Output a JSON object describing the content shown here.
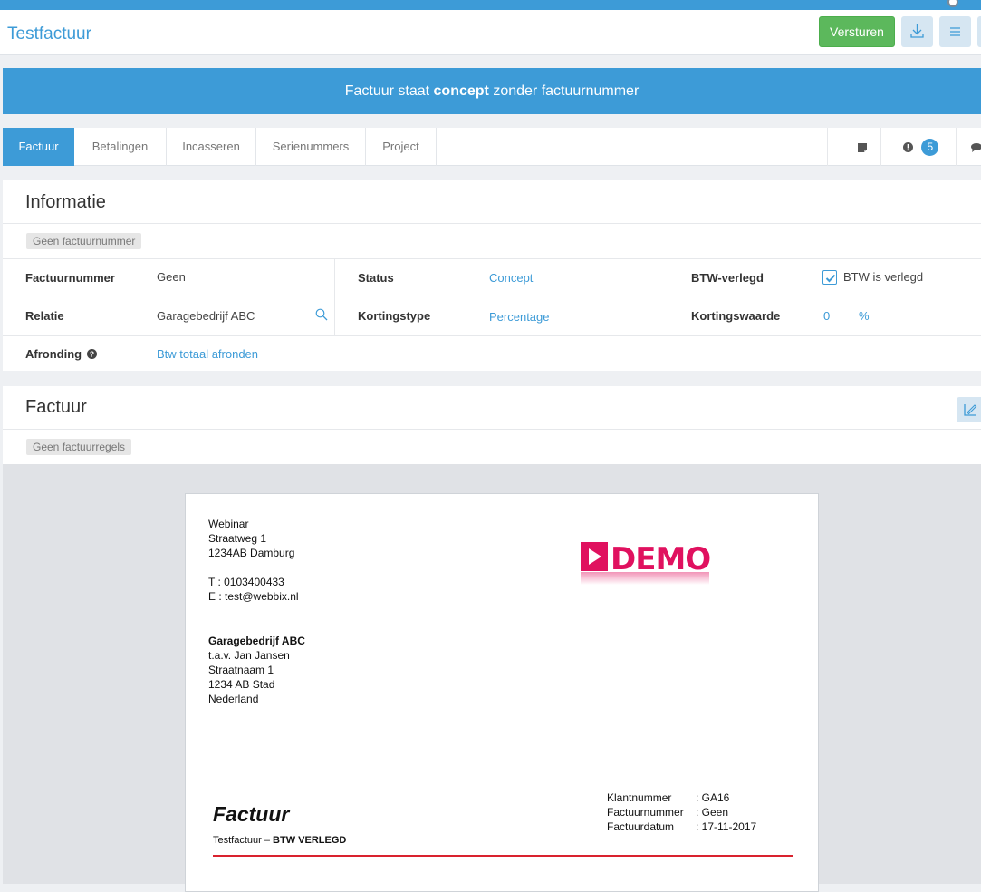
{
  "header": {
    "title": "Testfactuur",
    "send_label": "Versturen"
  },
  "banner": {
    "prefix": "Factuur staat ",
    "emphasis": "concept",
    "suffix": " zonder factuurnummer"
  },
  "tabs": [
    {
      "label": "Factuur",
      "active": true
    },
    {
      "label": "Betalingen"
    },
    {
      "label": "Incasseren"
    },
    {
      "label": "Serienummers"
    },
    {
      "label": "Project"
    }
  ],
  "tab_icons": {
    "alerts_count": "5"
  },
  "info": {
    "title": "Informatie",
    "tag": "Geen factuurnummer",
    "fields": {
      "factuurnummer_label": "Factuurnummer",
      "factuurnummer_value": "Geen",
      "status_label": "Status",
      "status_value": "Concept",
      "btw_label": "BTW-verlegd",
      "btw_value": "BTW is verlegd",
      "btw_checked": true,
      "relatie_label": "Relatie",
      "relatie_value": "Garagebedrijf ABC",
      "kortingstype_label": "Kortingstype",
      "kortingstype_value": "Percentage",
      "kortingswaarde_label": "Kortingswaarde",
      "kortingswaarde_value": "0",
      "kortingswaarde_unit": "%",
      "afronding_label": "Afronding",
      "afronding_value": "Btw totaal afronden"
    }
  },
  "factuur": {
    "title": "Factuur",
    "tag": "Geen factuurregels"
  },
  "invoice": {
    "sender": [
      "Webinar",
      "Straatweg 1",
      "1234AB Damburg"
    ],
    "contact": [
      "T : 0103400433",
      "E : test@webbix.nl"
    ],
    "recipient_name": "Garagebedrijf ABC",
    "recipient": [
      "t.a.v. Jan Jansen",
      "Straatnaam 1",
      "1234 AB Stad",
      "Nederland"
    ],
    "logo_text": "DEMO",
    "heading": "Factuur",
    "subtitle_prefix": "Testfactuur – ",
    "subtitle_bold": "BTW VERLEGD",
    "meta": [
      {
        "label": "Klantnummer",
        "value": ": GA16"
      },
      {
        "label": "Factuurnummer",
        "value": ": Geen"
      },
      {
        "label": "Factuurdatum",
        "value": ": 17-11-2017"
      }
    ],
    "accent_color": "#d9222e",
    "logo_color": "#e0115f"
  },
  "colors": {
    "primary": "#3d9bd7",
    "success": "#5cb85c"
  }
}
